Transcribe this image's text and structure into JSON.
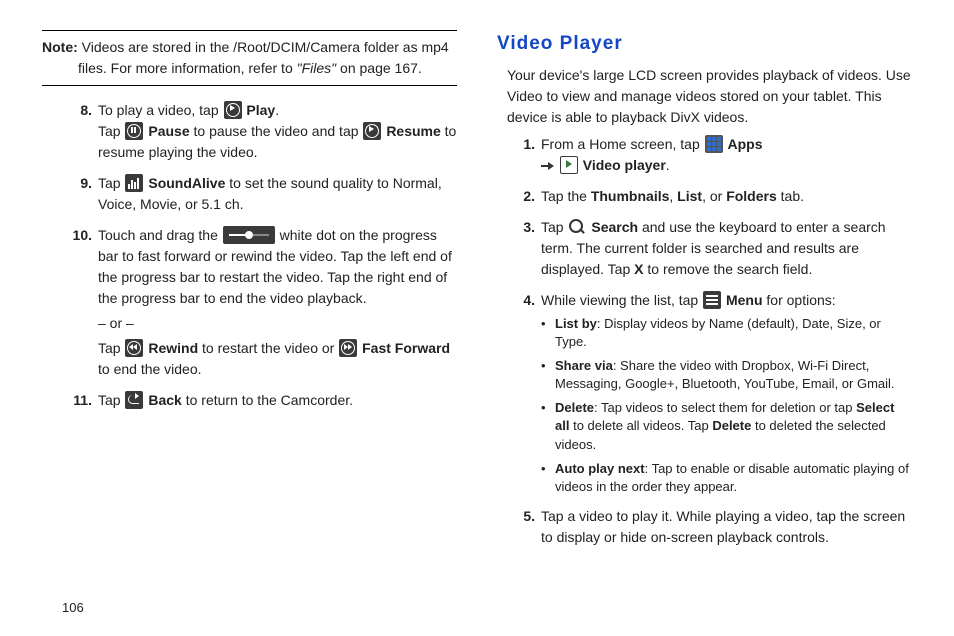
{
  "page_number": "106",
  "left": {
    "note": {
      "label": "Note:",
      "line1": "Videos are stored in the /Root/DCIM/Camera folder as mp4 files. For more information, refer to",
      "files_ref": "\"Files\"",
      "line1b": " on page 167.",
      "page_ref": "page 167."
    },
    "steps": [
      {
        "num": "8.",
        "line1a": "To play a video, tap ",
        "play_label": "Play",
        "line1b": ".",
        "line2a": "Tap ",
        "pause_label": "Pause",
        "line2b": " to pause the video and tap ",
        "resume_label": "Resume",
        "line2c": " to resume playing the video."
      },
      {
        "num": "9.",
        "a": "Tap ",
        "sa_label": "SoundAlive",
        "b": " to set the sound quality to Normal, Voice, Movie, or 5.1 ch."
      },
      {
        "num": "10.",
        "a": "Touch and drag the ",
        "b": " white dot on the progress bar to fast forward or rewind the video. Tap the left end of the progress bar to restart the video. Tap the right end of the progress bar to end the video playback.",
        "or": "– or –",
        "c": "Tap ",
        "rewind_label": "Rewind",
        "d": " to restart the video or ",
        "ff_label": "Fast Forward",
        "e": " to end the video."
      },
      {
        "num": "11.",
        "a": "Tap ",
        "back_label": "Back",
        "b": " to return to the Camcorder."
      }
    ]
  },
  "right": {
    "title": "Video Player",
    "intro": "Your device's large LCD screen provides playback of videos. Use Video to view and manage videos stored on your tablet. This device is able to playback DivX videos.",
    "steps": [
      {
        "num": "1.",
        "a": "From a Home screen, tap ",
        "apps_label": "Apps",
        "vp_label": "Video player",
        "b": "."
      },
      {
        "num": "2.",
        "a": "Tap the ",
        "thumb": "Thumbnails",
        "c1": ", ",
        "list": "List",
        "c2": ", or ",
        "folders": "Folders",
        "b": " tab."
      },
      {
        "num": "3.",
        "a": "Tap ",
        "search_label": "Search",
        "b": " and use the keyboard to enter a search term. The current folder is searched and results are displayed. Tap ",
        "x": "X",
        "c": " to remove the search field."
      },
      {
        "num": "4.",
        "a": "While viewing the list, tap ",
        "menu_label": "Menu",
        "b": " for options:",
        "bullets": [
          {
            "t": "List by",
            "d": ": Display videos by Name (default), Date, Size, or Type."
          },
          {
            "t": "Share via",
            "d": ": Share the video with Dropbox, Wi-Fi Direct, Messaging, Google+, Bluetooth, YouTube, Email, or Gmail."
          },
          {
            "t": "Delete",
            "d1": ": Tap videos to select them for deletion or tap ",
            "sa": "Select all",
            "d2": " to delete all videos. Tap ",
            "del": "Delete",
            "d3": " to deleted the selected videos."
          },
          {
            "t": "Auto play next",
            "d": ": Tap to enable or disable automatic playing of videos in the order they appear."
          }
        ]
      },
      {
        "num": "5.",
        "a": "Tap a video to play it. While playing a video, tap the screen to display or hide on-screen playback controls."
      }
    ]
  }
}
